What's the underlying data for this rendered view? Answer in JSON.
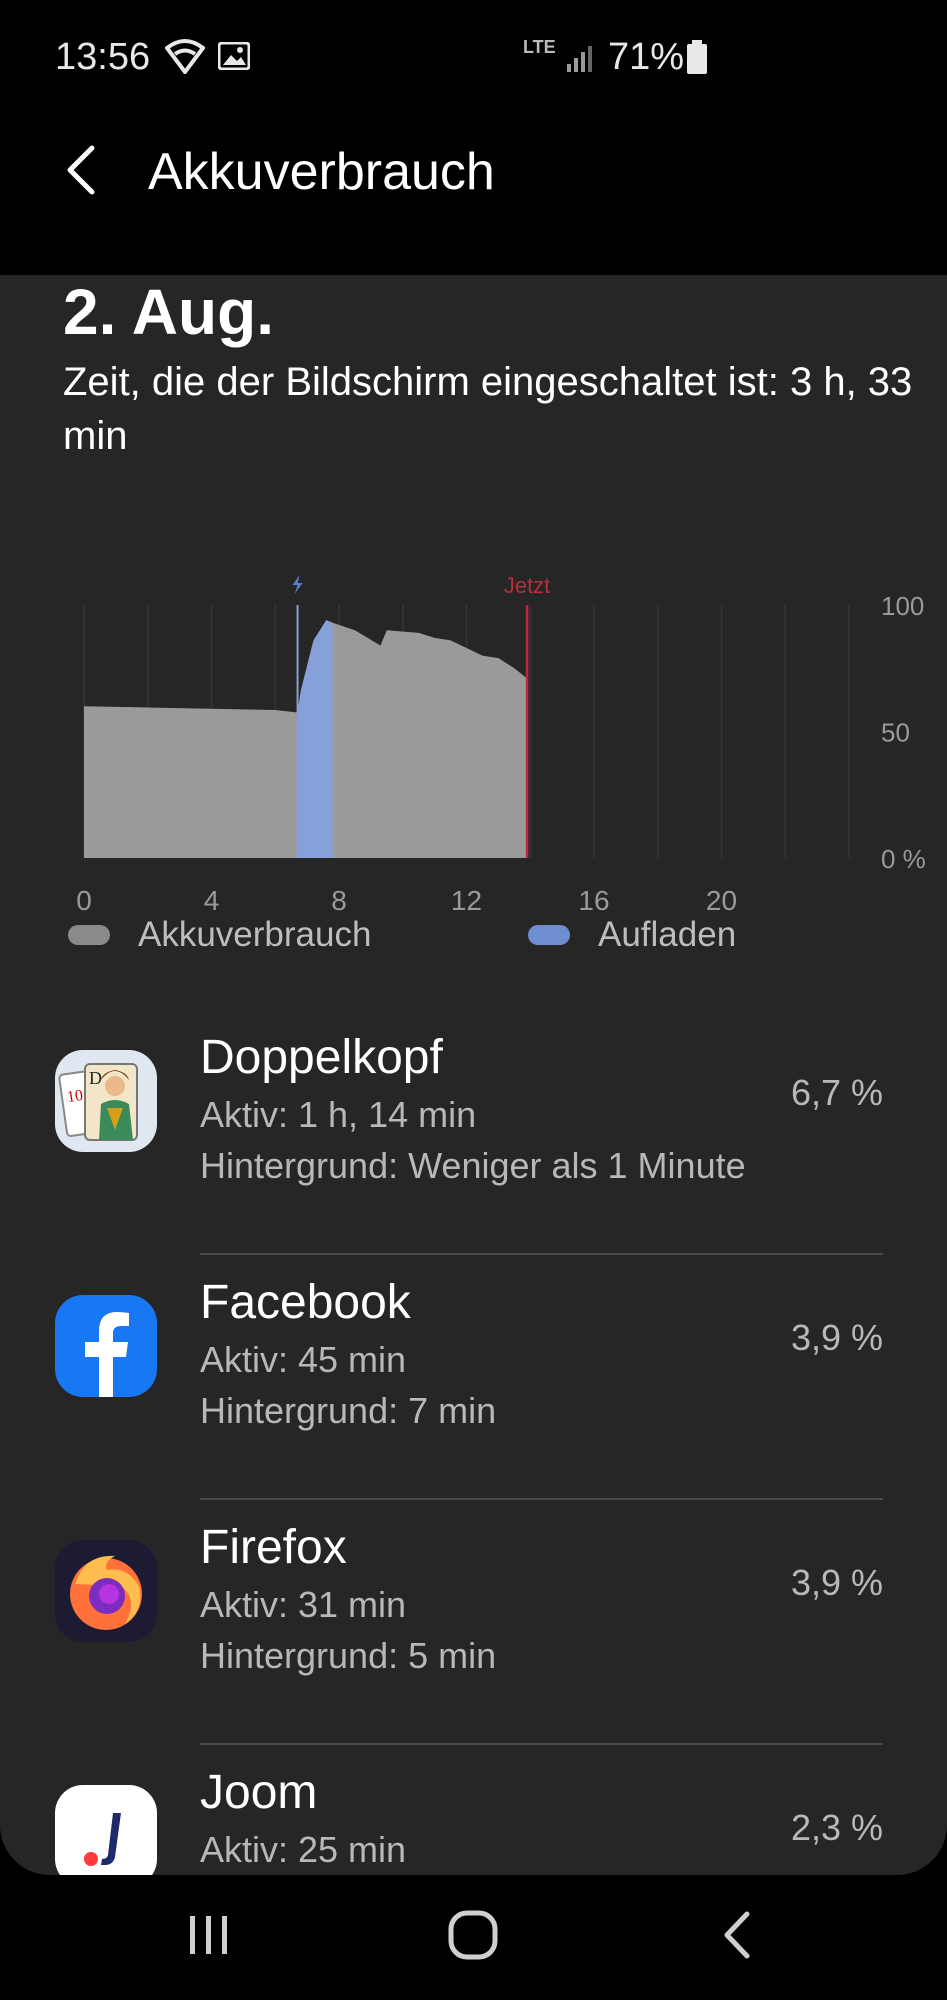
{
  "status_bar": {
    "time": "13:56",
    "network": "LTE",
    "battery_percent": "71%"
  },
  "header": {
    "title": "Akkuverbrauch"
  },
  "summary": {
    "date": "2. Aug.",
    "screen_on_time": "Zeit, die der Bildschirm eingeschaltet ist: 3 h, 33 min"
  },
  "chart_data": {
    "type": "area",
    "x_ticks": [
      "0",
      "4",
      "8",
      "12",
      "16",
      "20"
    ],
    "y_ticks": [
      "100",
      "50",
      "0 %"
    ],
    "xlim": [
      0,
      24
    ],
    "ylim": [
      0,
      100
    ],
    "now_label": "Jetzt",
    "now_x": 13.9,
    "charge_start_x": 6.7,
    "charge_end_x": 7.8,
    "series": [
      {
        "name": "Akkuverbrauch",
        "color": "#9a9a9a",
        "x": [
          0,
          2,
          4,
          6,
          6.7,
          6.8,
          7.2,
          7.6,
          7.8,
          8.5,
          9.3,
          9.5,
          10.5,
          11,
          11.5,
          12,
          12.5,
          13,
          13.5,
          13.9
        ],
        "y": [
          60,
          59.5,
          59,
          58.5,
          57.5,
          66,
          86,
          94,
          93,
          90,
          84,
          90,
          89,
          87,
          86,
          83,
          80,
          79,
          75,
          71
        ]
      },
      {
        "name": "Aufladen",
        "color": "#86a0d9",
        "x": [
          6.7,
          7.8
        ],
        "y": [
          57.5,
          93
        ]
      }
    ]
  },
  "legend": {
    "usage_label": "Akkuverbrauch",
    "usage_color": "#8a8a8a",
    "charging_label": "Aufladen",
    "charging_color": "#6f8ed0"
  },
  "apps": [
    {
      "name": "Doppelkopf",
      "active": "Aktiv: 1 h, 14 min",
      "background": "Hintergrund: Weniger als 1 Minute",
      "percent": "6,7 %",
      "icon": "playing-cards-icon"
    },
    {
      "name": "Facebook",
      "active": "Aktiv: 45 min",
      "background": "Hintergrund: 7 min",
      "percent": "3,9 %",
      "icon": "facebook-icon"
    },
    {
      "name": "Firefox",
      "active": "Aktiv: 31 min",
      "background": "Hintergrund: 5 min",
      "percent": "3,9 %",
      "icon": "firefox-icon"
    },
    {
      "name": "Joom",
      "active": "Aktiv: 25 min",
      "background": "",
      "percent": "2,3 %",
      "icon": "joom-icon"
    }
  ]
}
